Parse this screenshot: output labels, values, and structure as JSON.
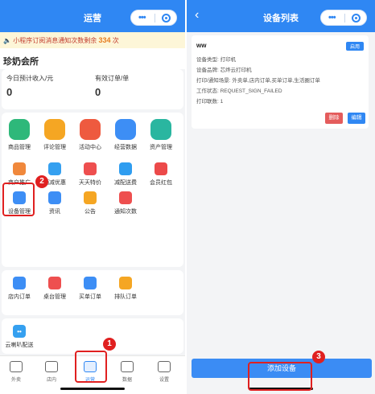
{
  "left": {
    "title": "运营",
    "notice": {
      "icon": "speaker-icon",
      "text": "小程序订阅消息通知次数剩余",
      "count": "334",
      "suffix": "次"
    },
    "shop_name": "珍奶会所",
    "income": [
      {
        "label": "今日预计收入/元",
        "value": "0"
      },
      {
        "label": "有效订单/单",
        "value": "0"
      }
    ],
    "grid": [
      {
        "label": "商品管理",
        "icon": "bag-icon",
        "color": "#2eb87a"
      },
      {
        "label": "评论管理",
        "icon": "chat-icon",
        "color": "#f5a623"
      },
      {
        "label": "活动中心",
        "icon": "percent-icon",
        "color": "#ee5a3f"
      },
      {
        "label": "经营数据",
        "icon": "bar-chart-icon",
        "color": "#3d8ef5"
      },
      {
        "label": "资产管理",
        "icon": "yen-icon",
        "color": "#2ab6a0"
      },
      {
        "label": "商户推广",
        "icon": "store-icon",
        "color": "#f0883c"
      },
      {
        "label": "满减优惠",
        "icon": "discount-icon",
        "color": "#35a0f0"
      },
      {
        "label": "天天特价",
        "icon": "tag-icon",
        "color": "#ee4f4f"
      },
      {
        "label": "减配送费",
        "icon": "delivery-icon",
        "color": "#2f9df0"
      },
      {
        "label": "会员红包",
        "icon": "red-packet-icon",
        "color": "#ec4a4a"
      },
      {
        "label": "设备管理",
        "icon": "device-icon",
        "color": "#3d8ef5"
      },
      {
        "label": "资讯",
        "icon": "news-icon",
        "color": "#3d8ef5"
      },
      {
        "label": "公告",
        "icon": "announcement-icon",
        "color": "#f5a623"
      },
      {
        "label": "通知次数",
        "icon": "alarm-icon",
        "color": "#ee4f4f"
      }
    ],
    "orders": [
      {
        "label": "店内订单",
        "icon": "clipboard-icon",
        "color": "#3d8ef5"
      },
      {
        "label": "桌台管理",
        "icon": "table-icon",
        "color": "#ee4f4f"
      },
      {
        "label": "买单订单",
        "icon": "receipt-icon",
        "color": "#3d8ef5"
      },
      {
        "label": "排队订单",
        "icon": "queue-icon",
        "color": "#f5a623"
      }
    ],
    "yun": {
      "label": "云喇叭配送",
      "icon": "cloud-speaker-icon",
      "color": "#35a0f0"
    },
    "tabs": [
      {
        "label": "外卖",
        "icon": "clipboard-icon"
      },
      {
        "label": "店内",
        "icon": "dining-icon"
      },
      {
        "label": "运营",
        "icon": "operations-icon"
      },
      {
        "label": "数据",
        "icon": "chart-icon"
      },
      {
        "label": "设置",
        "icon": "gear-icon"
      }
    ],
    "active_tab": "运营"
  },
  "right": {
    "title": "设备列表",
    "device": {
      "name": "ww",
      "status_tag": "启用",
      "fields": [
        "设备类型: 打印机",
        "设备品牌: 芯烨云打印机",
        "打印/通知场景: 外卖单,店内订单,买单订单,生活圈订单",
        "工作状态: REQUEST_SIGN_FAILED",
        "打印联数: 1"
      ],
      "delete_label": "删除",
      "edit_label": "编辑"
    },
    "add_button": "添加设备"
  },
  "annotations": [
    "1",
    "2",
    "3"
  ],
  "colors": {
    "primary": "#2f87f3",
    "danger": "#e45c5c",
    "highlight": "#e02020"
  }
}
